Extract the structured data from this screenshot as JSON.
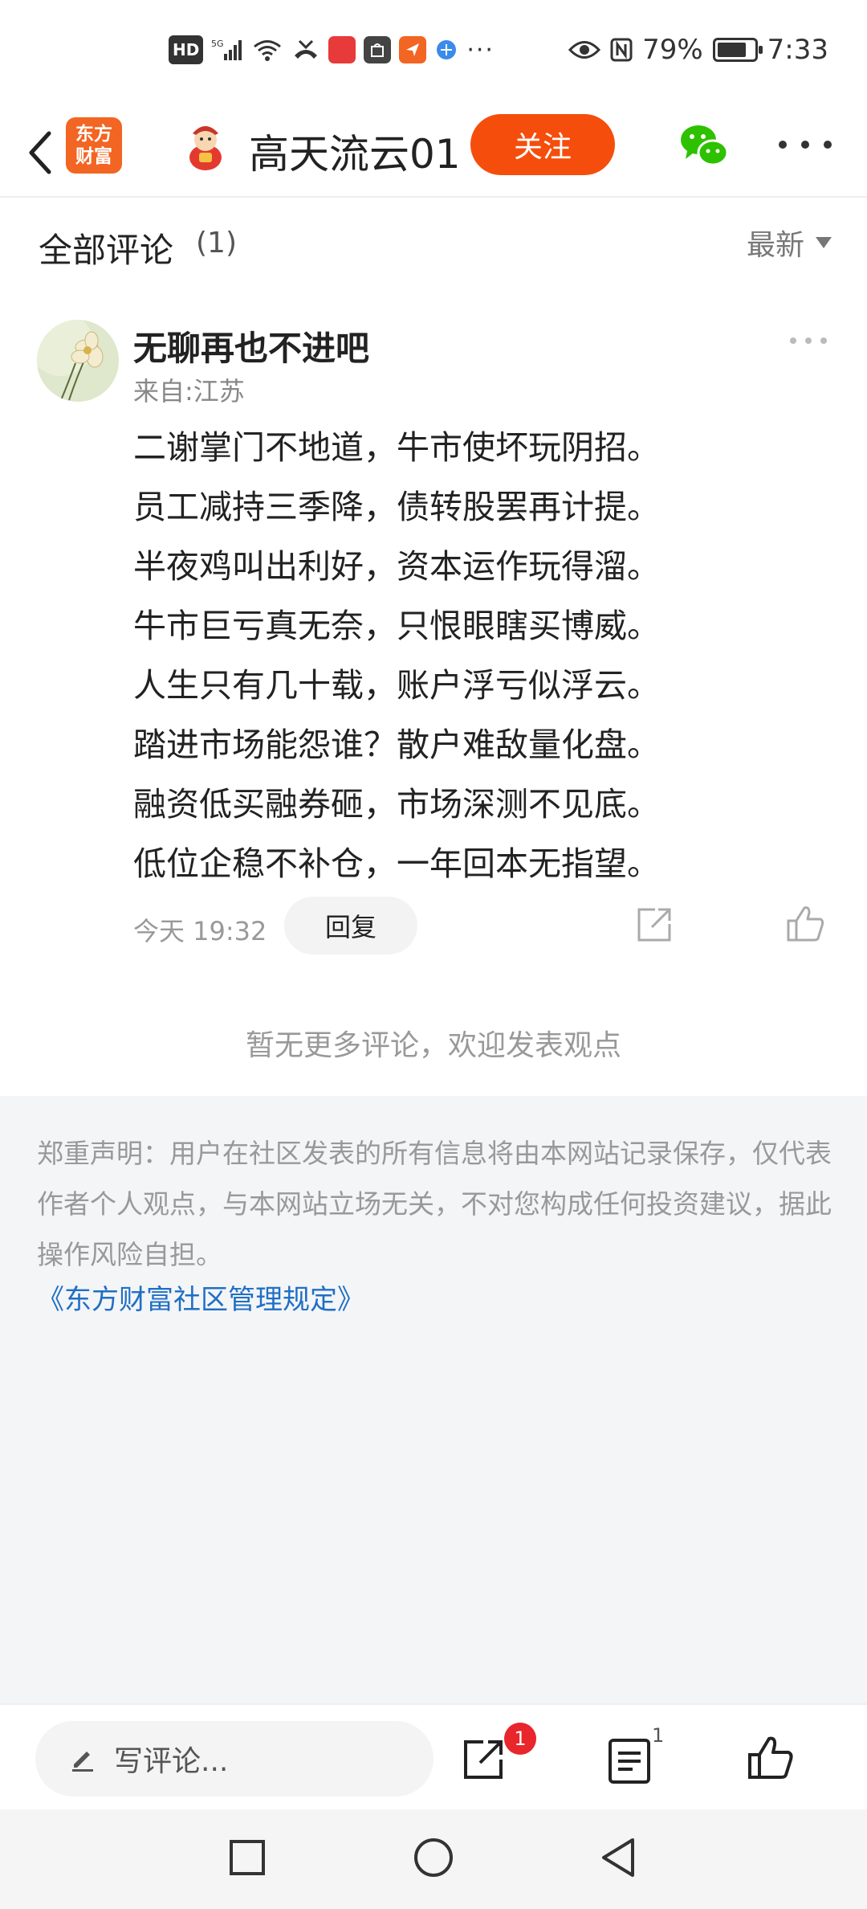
{
  "status_bar": {
    "hd_label": "HD",
    "network_label": "5G",
    "more_dots": "···",
    "battery_text": "79%",
    "battery_level": 0.79,
    "time": "7:33"
  },
  "header": {
    "logo_line1": "东方",
    "logo_line2": "财富",
    "title": "高天流云01",
    "follow_label": "关注"
  },
  "comments": {
    "title": "全部评论",
    "count": "(1)",
    "sort_label": "最新"
  },
  "comment": {
    "username": "无聊再也不进吧",
    "location": "来自:江苏",
    "lines": [
      "二谢掌门不地道，牛市使坏玩阴招。",
      "员工减持三季降，债转股罢再计提。",
      "半夜鸡叫出利好，资本运作玩得溜。",
      "牛市巨亏真无奈，只恨眼瞎买博威。",
      "人生只有几十载，账户浮亏似浮云。",
      "踏进市场能怨谁？散户难敌量化盘。",
      "融资低买融券砸，市场深测不见底。",
      "低位企稳不补仓，一年回本无指望。"
    ],
    "time": "今天 19:32",
    "reply_label": "回复"
  },
  "no_more_text": "暂无更多评论，欢迎发表观点",
  "disclaimer": {
    "text": "郑重声明：用户在社区发表的所有信息将由本网站记录保存，仅代表作者个人观点，与本网站立场无关，不对您构成任何投资建议，据此操作风险自担。",
    "link": "《东方财富社区管理规定》"
  },
  "bottom_bar": {
    "input_placeholder": "写评论...",
    "share_badge": "1",
    "list_count": "1"
  },
  "colors": {
    "brand_orange": "#f54e0c",
    "link_blue": "#1f6fc5",
    "badge_red": "#e8262c",
    "wechat_green": "#2dc100"
  }
}
